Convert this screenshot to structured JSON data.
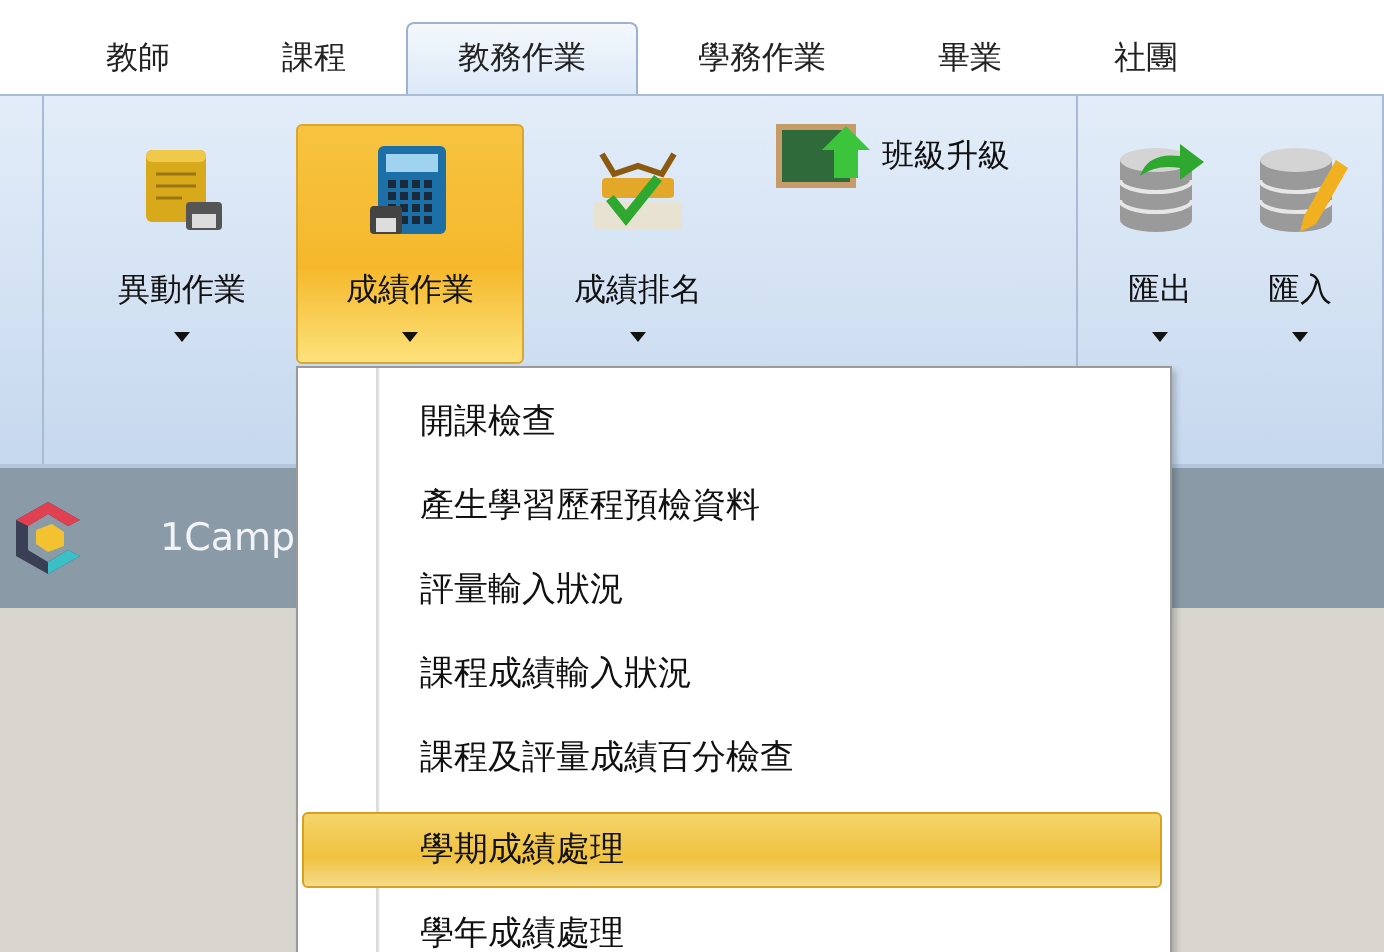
{
  "tabs": [
    {
      "label": "教師",
      "selected": false
    },
    {
      "label": "課程",
      "selected": false
    },
    {
      "label": "教務作業",
      "selected": true
    },
    {
      "label": "學務作業",
      "selected": false
    },
    {
      "label": "畢業",
      "selected": false
    },
    {
      "label": "社團",
      "selected": false
    }
  ],
  "ribbon_groups": [
    {
      "buttons": [
        {
          "kind": "large",
          "label": "異動作業",
          "dropdown": true,
          "selected": false
        },
        {
          "kind": "large",
          "label": "成績作業",
          "dropdown": true,
          "selected": true
        },
        {
          "kind": "large",
          "label": "成績排名",
          "dropdown": true,
          "selected": false
        },
        {
          "kind": "small",
          "label": "班級升級",
          "selected": false
        }
      ]
    },
    {
      "buttons": [
        {
          "kind": "large",
          "label": "匯出",
          "dropdown": true,
          "selected": false
        },
        {
          "kind": "large",
          "label": "匯入",
          "dropdown": true,
          "selected": false
        }
      ]
    }
  ],
  "banner": {
    "title": "1Camp"
  },
  "menu": [
    {
      "kind": "item",
      "label": "開課檢查",
      "selected": false
    },
    {
      "kind": "item",
      "label": "產生學習歷程預檢資料",
      "selected": false
    },
    {
      "kind": "item",
      "label": "評量輸入狀況",
      "selected": false
    },
    {
      "kind": "item",
      "label": "課程成績輸入狀況",
      "selected": false
    },
    {
      "kind": "item",
      "label": "課程及評量成績百分檢查",
      "selected": false
    },
    {
      "kind": "separator"
    },
    {
      "kind": "item",
      "label": "學期成績處理",
      "selected": true
    },
    {
      "kind": "item",
      "label": "學年成績處理",
      "selected": false
    }
  ]
}
